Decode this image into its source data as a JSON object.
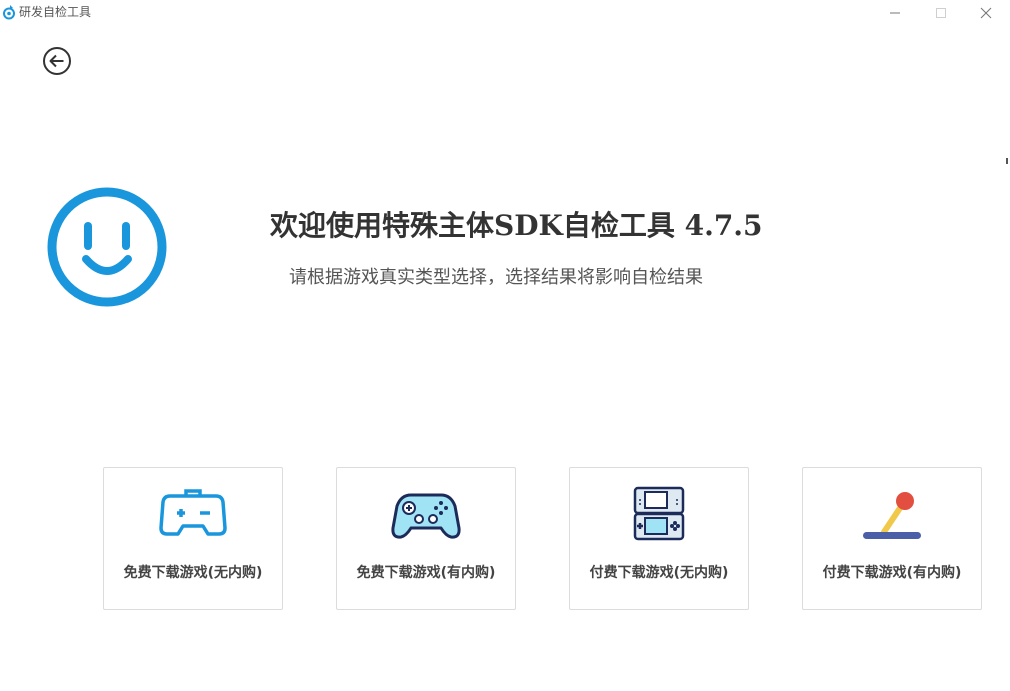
{
  "window": {
    "title": "研发自检工具",
    "minimize_label": "",
    "maximize_label": "",
    "close_label": ""
  },
  "colors": {
    "accent": "#1a96dc",
    "text_dark": "#333333",
    "text_sub": "#555555",
    "card_border": "#dcdcdc"
  },
  "main": {
    "back_icon": "back-arrow-icon",
    "logo_icon": "smiley-face-icon",
    "title": "欢迎使用特殊主体SDK自检工具 4.7.5",
    "subtitle": "请根据游戏真实类型选择，选择结果将影响自检结果"
  },
  "cards": [
    {
      "label": "免费下载游戏(无内购)",
      "icon": "gamepad-outline-icon"
    },
    {
      "label": "免费下载游戏(有内购)",
      "icon": "gamepad-color-icon"
    },
    {
      "label": "付费下载游戏(无内购)",
      "icon": "handheld-console-icon"
    },
    {
      "label": "付费下载游戏(有内购)",
      "icon": "joystick-icon"
    }
  ]
}
